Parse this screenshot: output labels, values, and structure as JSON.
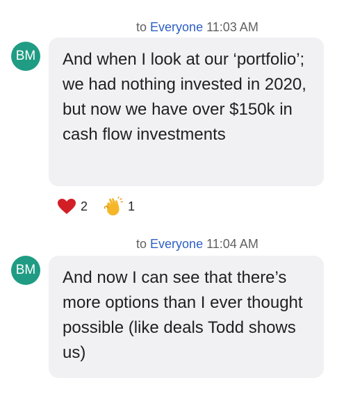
{
  "messages": [
    {
      "to_label": "to",
      "recipient": "Everyone",
      "time": "11:03 AM",
      "avatar_initials": "BM",
      "text": "And when I look at our ‘portfolio’; we had nothing invested in 2020, but now we have over $150k in cash flow investments",
      "reactions": [
        {
          "icon": "heart-icon",
          "count": "2",
          "color": "#d21f26"
        },
        {
          "icon": "clapping-hands-icon",
          "count": "1",
          "color": "#f5b62a"
        }
      ]
    },
    {
      "to_label": "to",
      "recipient": "Everyone",
      "time": "11:04 AM",
      "avatar_initials": "BM",
      "text": "And now I can see that there’s more options than I ever thought possible (like deals Todd shows us)"
    }
  ],
  "colors": {
    "avatar_bg": "#1f9c83",
    "bubble_bg": "#f1f1f4",
    "recipient": "#2d5fc4",
    "meta_text": "#616161"
  }
}
